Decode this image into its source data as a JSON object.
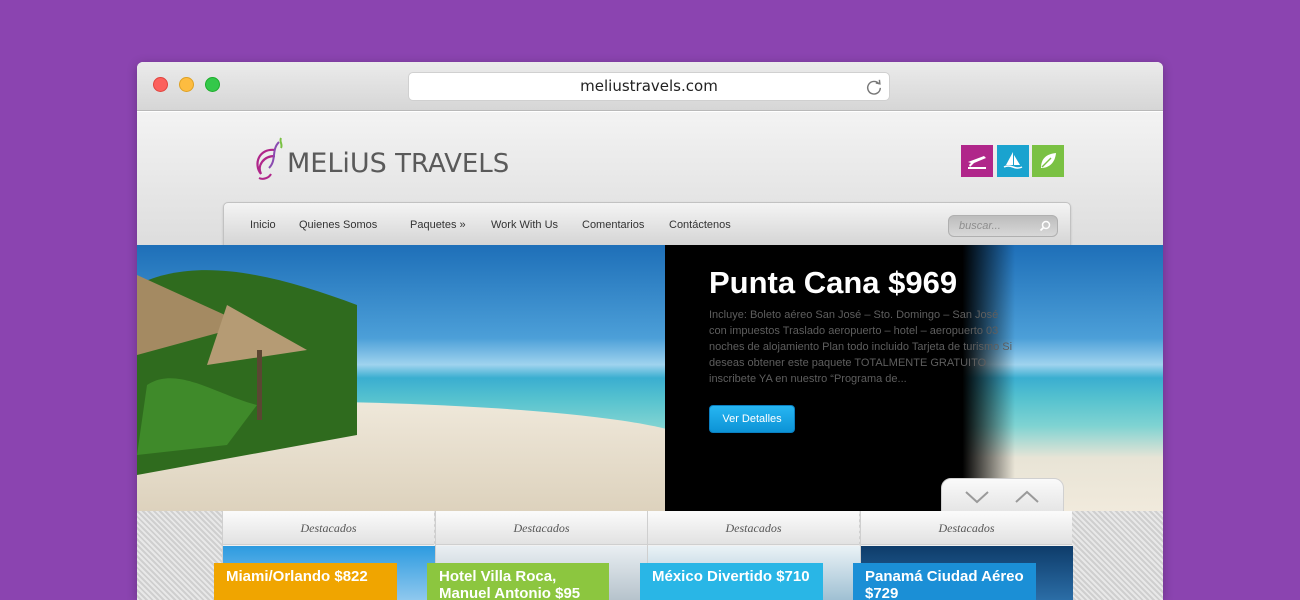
{
  "browser": {
    "url": "meliustravels.com"
  },
  "brand": {
    "name_prefix": "MELiUS",
    "name_suffix": "TRAVELS",
    "colors": {
      "purple": "#b0268a",
      "blue": "#1aa3cf",
      "green": "#7ac143"
    }
  },
  "social_icons": [
    "plane-icon",
    "sailboat-icon",
    "leaf-icon"
  ],
  "nav": {
    "items": [
      {
        "label": "Inicio"
      },
      {
        "label": "Quienes Somos"
      },
      {
        "label": "Paquetes »"
      },
      {
        "label": "Work With Us"
      },
      {
        "label": "Comentarios"
      },
      {
        "label": "Contáctenos"
      }
    ],
    "search_placeholder": "buscar..."
  },
  "hero": {
    "title": "Punta Cana $969",
    "description": "Incluye: Boleto aéreo San José – Sto. Domingo – San José con impuestos Traslado aeropuerto – hotel – aeropuerto 03 noches de alojamiento Plan todo incluido Tarjeta de turismo Si deseas obtener este paquete TOTALMENTE GRATUITO inscribete YA en nuestro “Programa de...",
    "button": "Ver Detalles"
  },
  "featured": [
    {
      "header": "Destacados",
      "tag": "Miami/Orlando $822",
      "color": "#f0a500"
    },
    {
      "header": "Destacados",
      "tag": "Hotel Villa Roca, Manuel Antonio $95",
      "color": "#8cc63f"
    },
    {
      "header": "Destacados",
      "tag": "México Divertido $710",
      "color": "#29b6e6"
    },
    {
      "header": "Destacados",
      "tag": "Panamá Ciudad Aéreo $729",
      "color": "#1b8fd6"
    }
  ]
}
